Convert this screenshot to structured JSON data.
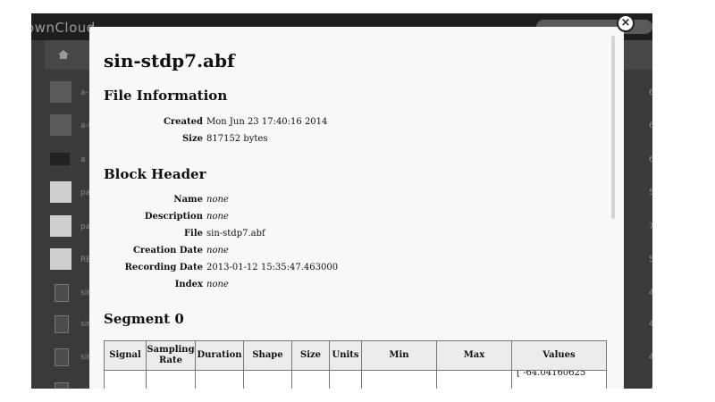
{
  "app": {
    "logo": "ownCloud",
    "files": [
      {
        "name": "a-",
        "date": "6 mo",
        "thumb": "dark"
      },
      {
        "name": "a-t",
        "date": "6 mo",
        "thumb": "dark"
      },
      {
        "name": "a",
        "date": "6 mo",
        "thumb": "gear"
      },
      {
        "name": "pa",
        "date": "5 mo",
        "thumb": "light"
      },
      {
        "name": "pa",
        "date": "7 mo",
        "thumb": "light"
      },
      {
        "name": "RE",
        "date": "5 mo",
        "thumb": "light"
      },
      {
        "name": "sir",
        "date": "4 mo",
        "thumb": "doc"
      },
      {
        "name": "sir",
        "date": "4 mo",
        "thumb": "doc"
      },
      {
        "name": "sir",
        "date": "4 mo",
        "thumb": "doc"
      },
      {
        "name": "sin",
        "date": "4 mo",
        "thumb": "doc"
      }
    ]
  },
  "modal": {
    "title": "sin-stdp7.abf",
    "close_label": "×",
    "file_info": {
      "heading": "File Information",
      "rows": [
        {
          "label": "Created",
          "value": "Mon Jun 23 17:40:16 2014"
        },
        {
          "label": "Size",
          "value": "817152 bytes"
        }
      ]
    },
    "block_header": {
      "heading": "Block Header",
      "rows": [
        {
          "label": "Name",
          "value": "none"
        },
        {
          "label": "Description",
          "value": "none"
        },
        {
          "label": "File",
          "value": "sin-stdp7.abf"
        },
        {
          "label": "Creation Date",
          "value": "none"
        },
        {
          "label": "Recording Date",
          "value": "2013-01-12 15:35:47.463000"
        },
        {
          "label": "Index",
          "value": "none"
        }
      ]
    },
    "segment": {
      "heading": "Segment 0",
      "columns": [
        "Signal",
        "Sampling Rate",
        "Duration",
        "Shape",
        "Size",
        "Units",
        "Min",
        "Max",
        "Values"
      ],
      "first_value_partial": "[ -64.04160625"
    }
  }
}
